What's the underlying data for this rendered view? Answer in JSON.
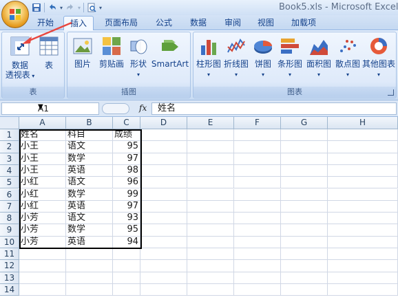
{
  "window": {
    "title": "Book5.xls - Microsoft Excel"
  },
  "tabs": [
    "开始",
    "插入",
    "页面布局",
    "公式",
    "数据",
    "审阅",
    "视图",
    "加载项"
  ],
  "active_tab": "插入",
  "ribbon": {
    "groups": [
      {
        "label": "表",
        "buttons": [
          {
            "label": "数据\n透视表",
            "icon": "pivot-table-icon"
          },
          {
            "label": "表",
            "icon": "table-icon"
          }
        ]
      },
      {
        "label": "插图",
        "buttons": [
          {
            "label": "图片",
            "icon": "picture-icon"
          },
          {
            "label": "剪贴画",
            "icon": "clipart-icon"
          },
          {
            "label": "形状",
            "icon": "shapes-icon"
          },
          {
            "label": "SmartArt",
            "icon": "smartart-icon"
          }
        ]
      },
      {
        "label": "图表",
        "buttons": [
          {
            "label": "柱形图",
            "icon": "column-chart-icon"
          },
          {
            "label": "折线图",
            "icon": "line-chart-icon"
          },
          {
            "label": "饼图",
            "icon": "pie-chart-icon"
          },
          {
            "label": "条形图",
            "icon": "bar-chart-icon"
          },
          {
            "label": "面积图",
            "icon": "area-chart-icon"
          },
          {
            "label": "散点图",
            "icon": "scatter-chart-icon"
          },
          {
            "label": "其他图表",
            "icon": "other-charts-icon"
          }
        ]
      }
    ]
  },
  "formula_bar": {
    "name_box": "A1",
    "fx_label": "fx",
    "formula": "姓名"
  },
  "columns": [
    "A",
    "B",
    "C",
    "D",
    "E",
    "F",
    "G",
    "H"
  ],
  "rows": [
    "1",
    "2",
    "3",
    "4",
    "5",
    "6",
    "7",
    "8",
    "9",
    "10",
    "11",
    "12",
    "13",
    "14"
  ],
  "cells": [
    [
      "姓名",
      "科目",
      "成绩"
    ],
    [
      "小王",
      "语文",
      "95"
    ],
    [
      "小王",
      "数学",
      "97"
    ],
    [
      "小王",
      "英语",
      "98"
    ],
    [
      "小红",
      "语文",
      "96"
    ],
    [
      "小红",
      "数学",
      "99"
    ],
    [
      "小红",
      "英语",
      "97"
    ],
    [
      "小芳",
      "语文",
      "93"
    ],
    [
      "小芳",
      "数学",
      "95"
    ],
    [
      "小芳",
      "英语",
      "94"
    ]
  ],
  "colors": {
    "accent": "#15428b",
    "annotation_arrow": "#e8473f"
  }
}
